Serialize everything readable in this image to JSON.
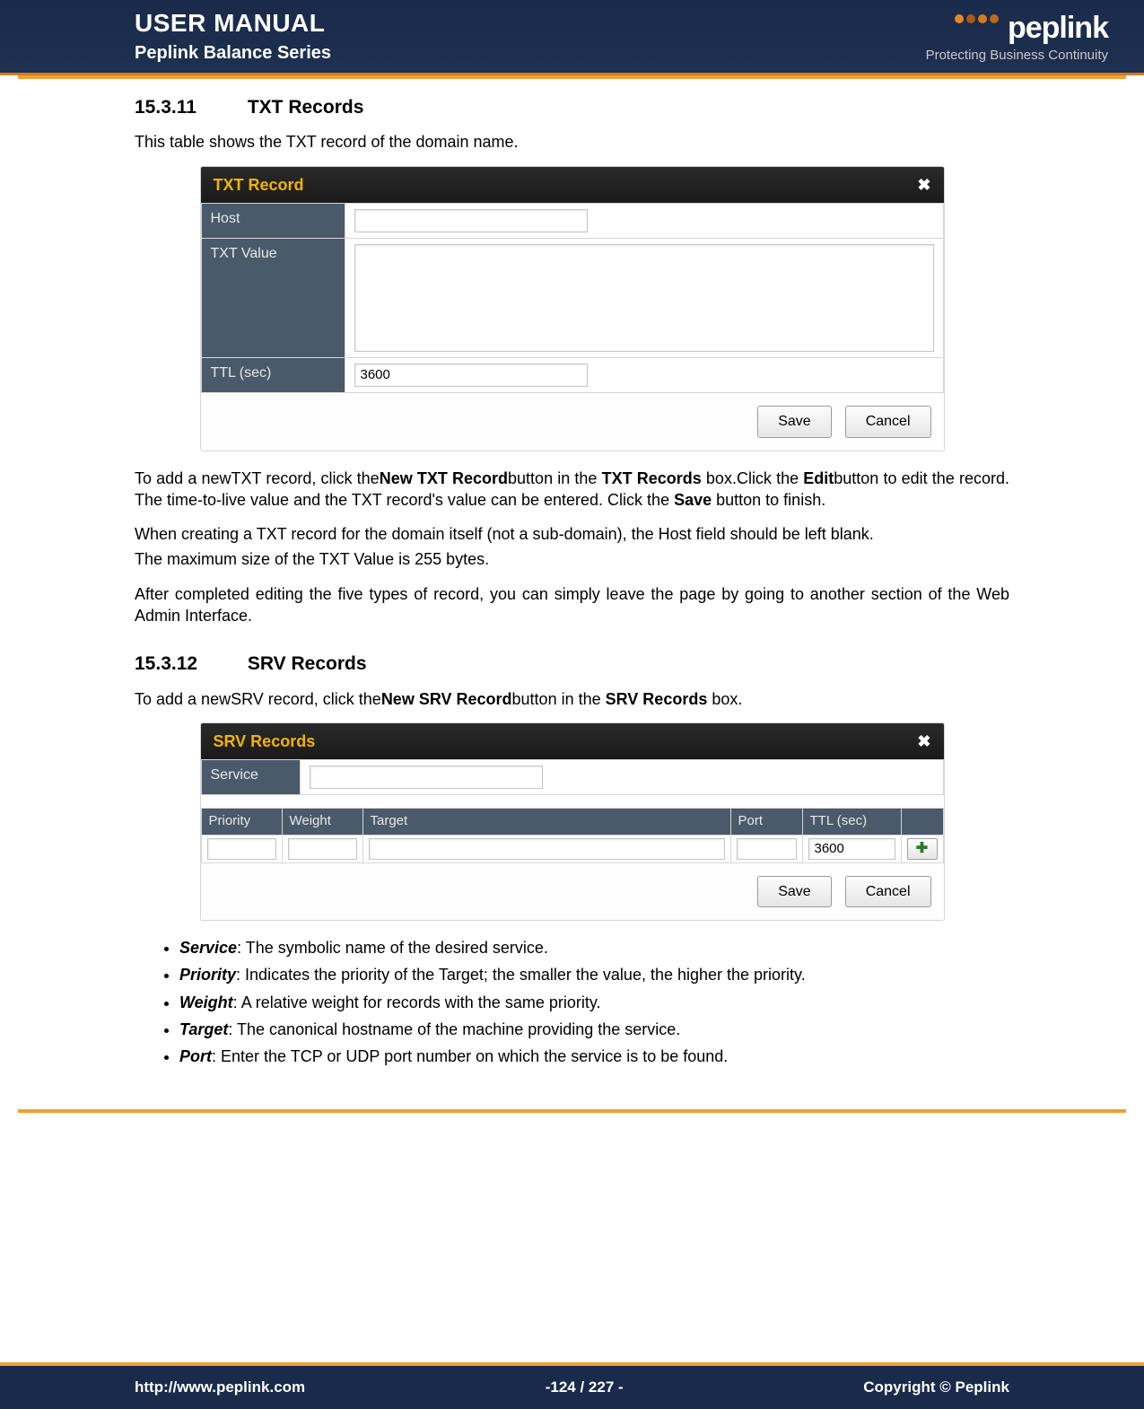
{
  "header": {
    "title": "USER MANUAL",
    "subtitle": "Peplink Balance Series",
    "brand": "peplink",
    "tagline": "Protecting Business Continuity"
  },
  "section1": {
    "num": "15.3.11",
    "title": "TXT Records",
    "intro": "This table shows the TXT record of the domain name.",
    "fig": {
      "title": "TXT Record",
      "host_label": "Host",
      "txtvalue_label": "TXT Value",
      "ttl_label": "TTL (sec)",
      "ttl_value": "3600",
      "save": "Save",
      "cancel": "Cancel"
    },
    "p1_a": "To add a newTXT record, click the",
    "p1_b": "New TXT Record",
    "p1_c": "button in the ",
    "p1_d": "TXT Records",
    "p1_e": " box.Click the ",
    "p1_f": "Edit",
    "p1_g": "button to edit the record. The time-to-live value and the TXT record's value can be entered. Click the ",
    "p1_h": "Save",
    "p1_i": " button to finish.",
    "p2": "When creating a TXT record for the domain itself (not a sub-domain), the Host field should be left blank.",
    "p3": "The maximum size of the TXT Value is 255 bytes.",
    "p4": "After completed editing the five types of record, you can simply leave the page by going to another section of the Web Admin Interface."
  },
  "section2": {
    "num": "15.3.12",
    "title": "SRV Records",
    "intro_a": "To add a newSRV record, click the",
    "intro_b": "New SRV Record",
    "intro_c": "button in the ",
    "intro_d": "SRV Records",
    "intro_e": " box.",
    "fig": {
      "title": "SRV Records",
      "service_label": "Service",
      "cols": {
        "priority": "Priority",
        "weight": "Weight",
        "target": "Target",
        "port": "Port",
        "ttl": "TTL (sec)"
      },
      "ttl_value": "3600",
      "save": "Save",
      "cancel": "Cancel"
    },
    "defs": [
      {
        "term": "Service",
        "sep": ": ",
        "text": "The symbolic name of the desired service."
      },
      {
        "term": "Priority",
        "sep": ": ",
        "text": "Indicates the priority of the Target; the smaller the value, the higher the priority."
      },
      {
        "term": "Weight",
        "sep": ": ",
        "text": "A relative weight for records with the same priority."
      },
      {
        "term": "Target",
        "sep": ": ",
        "text": "The canonical hostname of the machine providing the service."
      },
      {
        "term": "Port",
        "sep": ": ",
        "text": "Enter the TCP or UDP port number on which the service is to be found."
      }
    ]
  },
  "footer": {
    "url": "http://www.peplink.com",
    "page": "-124 / 227 -",
    "copyright": "Copyright ©  Peplink"
  }
}
